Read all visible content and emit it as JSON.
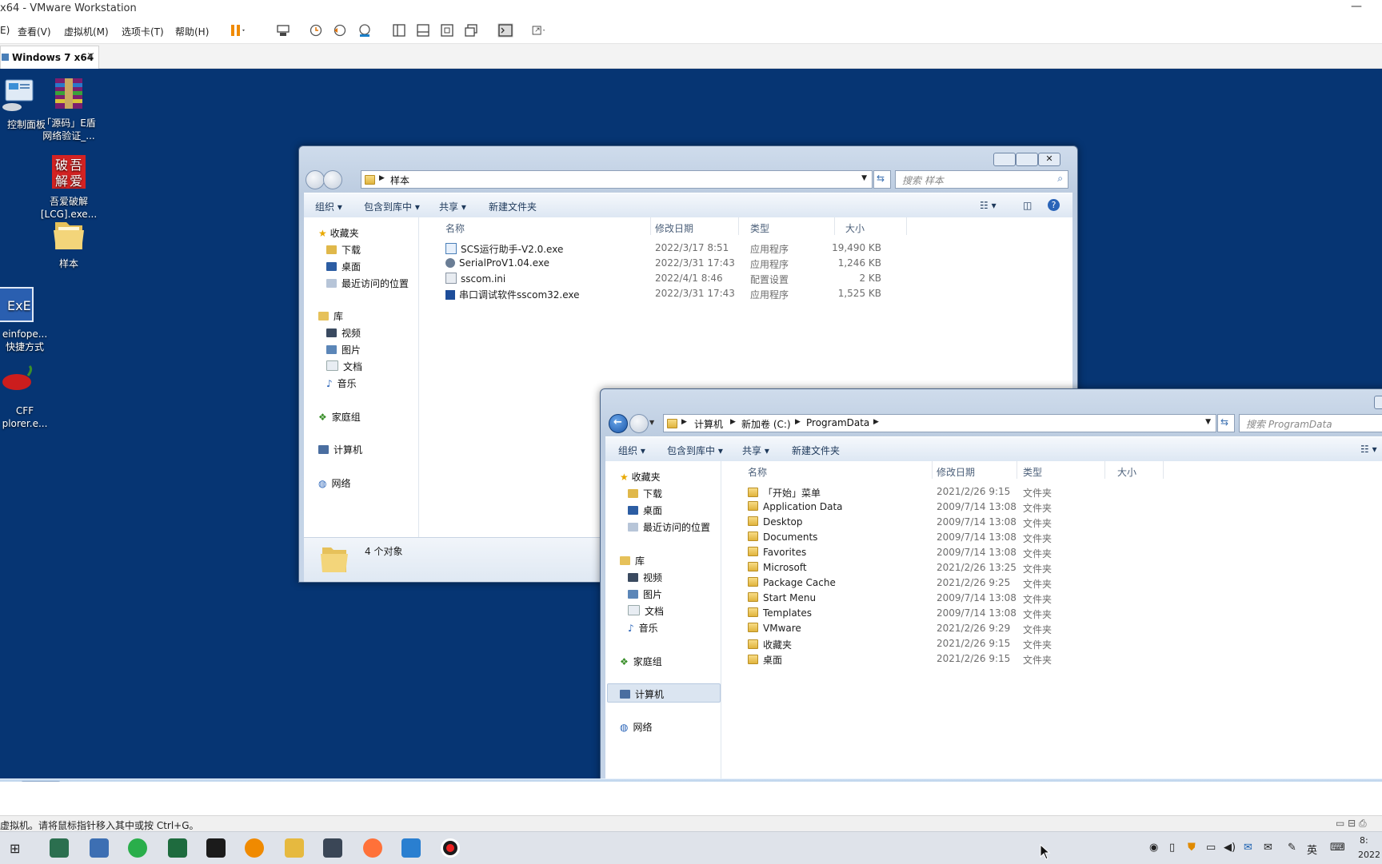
{
  "vmware": {
    "title": "x64 - VMware Workstation",
    "menus": [
      "E)",
      "查看(V)",
      "虚拟机(M)",
      "选项卡(T)",
      "帮助(H)"
    ],
    "tab_label": "Windows 7 x64",
    "status_text": "虚拟机。请将鼠标指针移入其中或按 Ctrl+G。"
  },
  "desktop": {
    "icons": [
      {
        "label1": "控制面板",
        "label2": ""
      },
      {
        "label1": "「源码」E盾",
        "label2": "网络验证_..."
      },
      {
        "label1": "吾爱破解",
        "label2": "[LCG].exe..."
      },
      {
        "label1": "样本",
        "label2": ""
      },
      {
        "label1": "einfope...",
        "label2": "快捷方式"
      },
      {
        "label1": "CFF",
        "label2": "plorer.e..."
      }
    ]
  },
  "window1": {
    "address": {
      "crumb": "样本"
    },
    "search_placeholder": "搜索 样本",
    "commands": [
      "组织 ▾",
      "包含到库中 ▾",
      "共享 ▾",
      "新建文件夹"
    ],
    "nav": {
      "favorites": "收藏夹",
      "downloads": "下载",
      "desktop": "桌面",
      "recent": "最近访问的位置",
      "libraries": "库",
      "videos": "视频",
      "pictures": "图片",
      "documents": "文档",
      "music": "音乐",
      "homegroup": "家庭组",
      "computer": "计算机",
      "network": "网络"
    },
    "columns": {
      "name": "名称",
      "date": "修改日期",
      "type": "类型",
      "size": "大小"
    },
    "files": [
      {
        "name": "SCS运行助手-V2.0.exe",
        "date": "2022/3/17 8:51",
        "type": "应用程序",
        "size": "19,490 KB"
      },
      {
        "name": "SerialProV1.04.exe",
        "date": "2022/3/31 17:43",
        "type": "应用程序",
        "size": "1,246 KB"
      },
      {
        "name": "sscom.ini",
        "date": "2022/4/1 8:46",
        "type": "配置设置",
        "size": "2 KB"
      },
      {
        "name": "串口调试软件sscom32.exe",
        "date": "2022/3/31 17:43",
        "type": "应用程序",
        "size": "1,525 KB"
      }
    ],
    "status": "4 个对象"
  },
  "window2": {
    "address": {
      "crumb1": "计算机",
      "crumb2": "新加卷 (C:)",
      "crumb3": "ProgramData"
    },
    "search_placeholder": "搜索 ProgramData",
    "commands": [
      "组织 ▾",
      "包含到库中 ▾",
      "共享 ▾",
      "新建文件夹"
    ],
    "nav": {
      "favorites": "收藏夹",
      "downloads": "下载",
      "desktop": "桌面",
      "recent": "最近访问的位置",
      "libraries": "库",
      "videos": "视频",
      "pictures": "图片",
      "documents": "文档",
      "music": "音乐",
      "homegroup": "家庭组",
      "computer": "计算机",
      "network": "网络"
    },
    "columns": {
      "name": "名称",
      "date": "修改日期",
      "type": "类型",
      "size": "大小"
    },
    "files": [
      {
        "name": "「开始」菜单",
        "date": "2021/2/26 9:15",
        "type": "文件夹",
        "locked": true
      },
      {
        "name": "Application Data",
        "date": "2009/7/14 13:08",
        "type": "文件夹",
        "locked": true
      },
      {
        "name": "Desktop",
        "date": "2009/7/14 13:08",
        "type": "文件夹",
        "locked": true
      },
      {
        "name": "Documents",
        "date": "2009/7/14 13:08",
        "type": "文件夹",
        "locked": true
      },
      {
        "name": "Favorites",
        "date": "2009/7/14 13:08",
        "type": "文件夹",
        "locked": true
      },
      {
        "name": "Microsoft",
        "date": "2021/2/26 13:25",
        "type": "文件夹",
        "locked": false
      },
      {
        "name": "Package Cache",
        "date": "2021/2/26 9:25",
        "type": "文件夹",
        "locked": false
      },
      {
        "name": "Start Menu",
        "date": "2009/7/14 13:08",
        "type": "文件夹",
        "locked": true
      },
      {
        "name": "Templates",
        "date": "2009/7/14 13:08",
        "type": "文件夹",
        "locked": true
      },
      {
        "name": "VMware",
        "date": "2021/2/26 9:29",
        "type": "文件夹",
        "locked": false
      },
      {
        "name": "收藏夹",
        "date": "2021/2/26 9:15",
        "type": "文件夹",
        "locked": true
      },
      {
        "name": "桌面",
        "date": "2021/2/26 9:15",
        "type": "文件夹",
        "locked": true
      }
    ]
  },
  "host_tray": {
    "ime": "英",
    "clock1": "8:",
    "clock2": "2022"
  },
  "colors": {
    "desktop": "#063573",
    "accent": "#1b56a9"
  }
}
